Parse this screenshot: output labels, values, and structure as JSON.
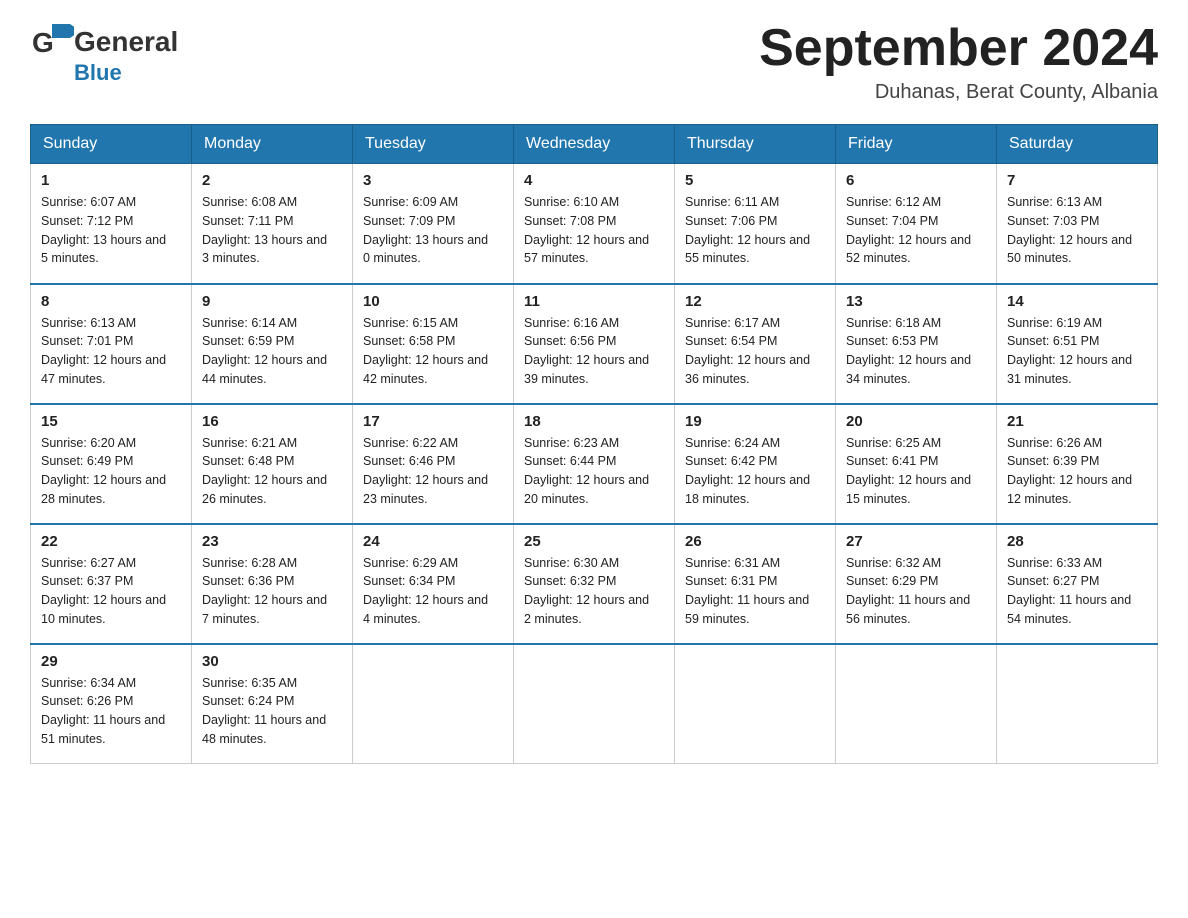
{
  "logo": {
    "general": "General",
    "blue": "Blue"
  },
  "title": "September 2024",
  "subtitle": "Duhanas, Berat County, Albania",
  "days": [
    "Sunday",
    "Monday",
    "Tuesday",
    "Wednesday",
    "Thursday",
    "Friday",
    "Saturday"
  ],
  "weeks": [
    [
      {
        "date": "1",
        "sunrise": "6:07 AM",
        "sunset": "7:12 PM",
        "daylight": "13 hours and 5 minutes."
      },
      {
        "date": "2",
        "sunrise": "6:08 AM",
        "sunset": "7:11 PM",
        "daylight": "13 hours and 3 minutes."
      },
      {
        "date": "3",
        "sunrise": "6:09 AM",
        "sunset": "7:09 PM",
        "daylight": "13 hours and 0 minutes."
      },
      {
        "date": "4",
        "sunrise": "6:10 AM",
        "sunset": "7:08 PM",
        "daylight": "12 hours and 57 minutes."
      },
      {
        "date": "5",
        "sunrise": "6:11 AM",
        "sunset": "7:06 PM",
        "daylight": "12 hours and 55 minutes."
      },
      {
        "date": "6",
        "sunrise": "6:12 AM",
        "sunset": "7:04 PM",
        "daylight": "12 hours and 52 minutes."
      },
      {
        "date": "7",
        "sunrise": "6:13 AM",
        "sunset": "7:03 PM",
        "daylight": "12 hours and 50 minutes."
      }
    ],
    [
      {
        "date": "8",
        "sunrise": "6:13 AM",
        "sunset": "7:01 PM",
        "daylight": "12 hours and 47 minutes."
      },
      {
        "date": "9",
        "sunrise": "6:14 AM",
        "sunset": "6:59 PM",
        "daylight": "12 hours and 44 minutes."
      },
      {
        "date": "10",
        "sunrise": "6:15 AM",
        "sunset": "6:58 PM",
        "daylight": "12 hours and 42 minutes."
      },
      {
        "date": "11",
        "sunrise": "6:16 AM",
        "sunset": "6:56 PM",
        "daylight": "12 hours and 39 minutes."
      },
      {
        "date": "12",
        "sunrise": "6:17 AM",
        "sunset": "6:54 PM",
        "daylight": "12 hours and 36 minutes."
      },
      {
        "date": "13",
        "sunrise": "6:18 AM",
        "sunset": "6:53 PM",
        "daylight": "12 hours and 34 minutes."
      },
      {
        "date": "14",
        "sunrise": "6:19 AM",
        "sunset": "6:51 PM",
        "daylight": "12 hours and 31 minutes."
      }
    ],
    [
      {
        "date": "15",
        "sunrise": "6:20 AM",
        "sunset": "6:49 PM",
        "daylight": "12 hours and 28 minutes."
      },
      {
        "date": "16",
        "sunrise": "6:21 AM",
        "sunset": "6:48 PM",
        "daylight": "12 hours and 26 minutes."
      },
      {
        "date": "17",
        "sunrise": "6:22 AM",
        "sunset": "6:46 PM",
        "daylight": "12 hours and 23 minutes."
      },
      {
        "date": "18",
        "sunrise": "6:23 AM",
        "sunset": "6:44 PM",
        "daylight": "12 hours and 20 minutes."
      },
      {
        "date": "19",
        "sunrise": "6:24 AM",
        "sunset": "6:42 PM",
        "daylight": "12 hours and 18 minutes."
      },
      {
        "date": "20",
        "sunrise": "6:25 AM",
        "sunset": "6:41 PM",
        "daylight": "12 hours and 15 minutes."
      },
      {
        "date": "21",
        "sunrise": "6:26 AM",
        "sunset": "6:39 PM",
        "daylight": "12 hours and 12 minutes."
      }
    ],
    [
      {
        "date": "22",
        "sunrise": "6:27 AM",
        "sunset": "6:37 PM",
        "daylight": "12 hours and 10 minutes."
      },
      {
        "date": "23",
        "sunrise": "6:28 AM",
        "sunset": "6:36 PM",
        "daylight": "12 hours and 7 minutes."
      },
      {
        "date": "24",
        "sunrise": "6:29 AM",
        "sunset": "6:34 PM",
        "daylight": "12 hours and 4 minutes."
      },
      {
        "date": "25",
        "sunrise": "6:30 AM",
        "sunset": "6:32 PM",
        "daylight": "12 hours and 2 minutes."
      },
      {
        "date": "26",
        "sunrise": "6:31 AM",
        "sunset": "6:31 PM",
        "daylight": "11 hours and 59 minutes."
      },
      {
        "date": "27",
        "sunrise": "6:32 AM",
        "sunset": "6:29 PM",
        "daylight": "11 hours and 56 minutes."
      },
      {
        "date": "28",
        "sunrise": "6:33 AM",
        "sunset": "6:27 PM",
        "daylight": "11 hours and 54 minutes."
      }
    ],
    [
      {
        "date": "29",
        "sunrise": "6:34 AM",
        "sunset": "6:26 PM",
        "daylight": "11 hours and 51 minutes."
      },
      {
        "date": "30",
        "sunrise": "6:35 AM",
        "sunset": "6:24 PM",
        "daylight": "11 hours and 48 minutes."
      },
      null,
      null,
      null,
      null,
      null
    ]
  ]
}
